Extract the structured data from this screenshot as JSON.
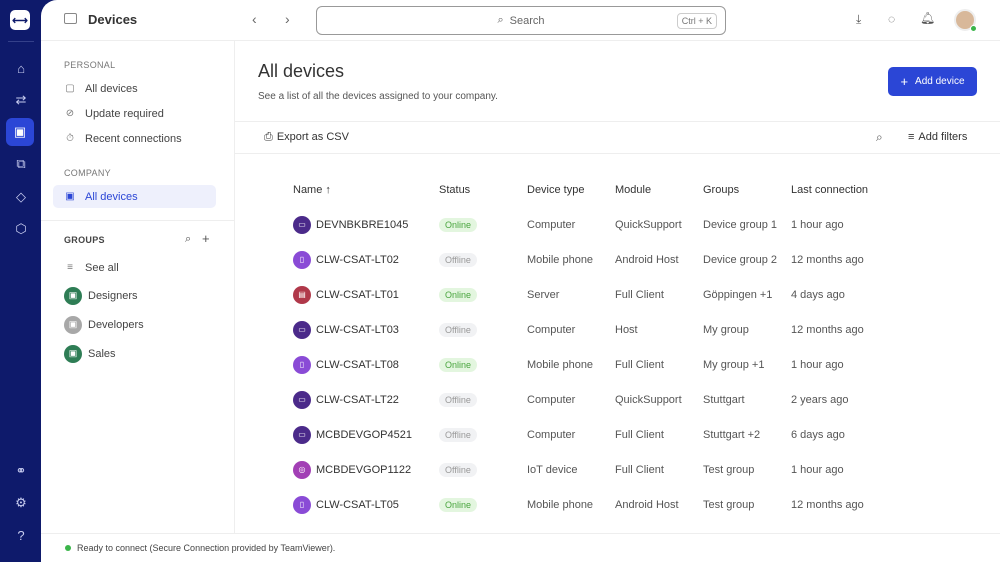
{
  "header": {
    "title": "Devices",
    "search_placeholder": "Search",
    "search_shortcut": "Ctrl + K"
  },
  "sidebar": {
    "personal_label": "PERSONAL",
    "personal": [
      {
        "label": "All devices",
        "icon": "user-device-icon"
      },
      {
        "label": "Update required",
        "icon": "update-icon"
      },
      {
        "label": "Recent connections",
        "icon": "timer-icon"
      }
    ],
    "company_label": "COMPANY",
    "company": [
      {
        "label": "All devices",
        "icon": "devices-icon"
      }
    ],
    "groups_label": "GROUPS",
    "see_all": "See all",
    "groups": [
      {
        "label": "Designers",
        "color": "#2e7d55"
      },
      {
        "label": "Developers",
        "color": "#a8a8a8"
      },
      {
        "label": "Sales",
        "color": "#2e7d55"
      }
    ]
  },
  "page": {
    "title": "All devices",
    "subtitle": "See a list of all the devices assigned to your company.",
    "add_device": "Add device",
    "export": "Export as CSV",
    "add_filters": "Add filters"
  },
  "table": {
    "headers": [
      "Name",
      "Status",
      "Device type",
      "Module",
      "Groups",
      "Last connection"
    ],
    "sort_indicator": "↑",
    "rows": [
      {
        "name": "DEVNBKBRE1045",
        "status": "Online",
        "type": "Computer",
        "module": "QuickSupport",
        "groups": "Device group 1",
        "last": "1 hour ago",
        "color": "#4b2a8a",
        "glyph": "▭"
      },
      {
        "name": "CLW-CSAT-LT02",
        "status": "Offline",
        "type": "Mobile phone",
        "module": "Android Host",
        "groups": "Device group 2",
        "last": "12 months ago",
        "color": "#8a4bd6",
        "glyph": "▯"
      },
      {
        "name": "CLW-CSAT-LT01",
        "status": "Online",
        "type": "Server",
        "module": "Full Client",
        "groups": "Göppingen +1",
        "last": "4 days ago",
        "color": "#b0384a",
        "glyph": "▤"
      },
      {
        "name": "CLW-CSAT-LT03",
        "status": "Offline",
        "type": "Computer",
        "module": "Host",
        "groups": "My group",
        "last": "12 months ago",
        "color": "#4b2a8a",
        "glyph": "▭"
      },
      {
        "name": "CLW-CSAT-LT08",
        "status": "Online",
        "type": "Mobile phone",
        "module": "Full Client",
        "groups": "My group +1",
        "last": "1 hour ago",
        "color": "#8a4bd6",
        "glyph": "▯"
      },
      {
        "name": "CLW-CSAT-LT22",
        "status": "Offline",
        "type": "Computer",
        "module": "QuickSupport",
        "groups": "Stuttgart",
        "last": "2 years ago",
        "color": "#4b2a8a",
        "glyph": "▭"
      },
      {
        "name": "MCBDEVGOP4521",
        "status": "Offline",
        "type": "Computer",
        "module": "Full Client",
        "groups": "Stuttgart +2",
        "last": "6 days ago",
        "color": "#4b2a8a",
        "glyph": "▭"
      },
      {
        "name": "MCBDEVGOP1122",
        "status": "Offline",
        "type": "IoT device",
        "module": "Full Client",
        "groups": "Test group",
        "last": "1 hour ago",
        "color": "#a23fb5",
        "glyph": "◎"
      },
      {
        "name": "CLW-CSAT-LT05",
        "status": "Online",
        "type": "Mobile phone",
        "module": "Android Host",
        "groups": "Test group",
        "last": "12 months ago",
        "color": "#8a4bd6",
        "glyph": "▯"
      }
    ]
  },
  "footer": {
    "status": "Ready to connect (Secure Connection provided by TeamViewer)."
  },
  "colors": {
    "rail": "#0e1a6b",
    "accent": "#2b46d6",
    "online": "#3bb54a"
  }
}
